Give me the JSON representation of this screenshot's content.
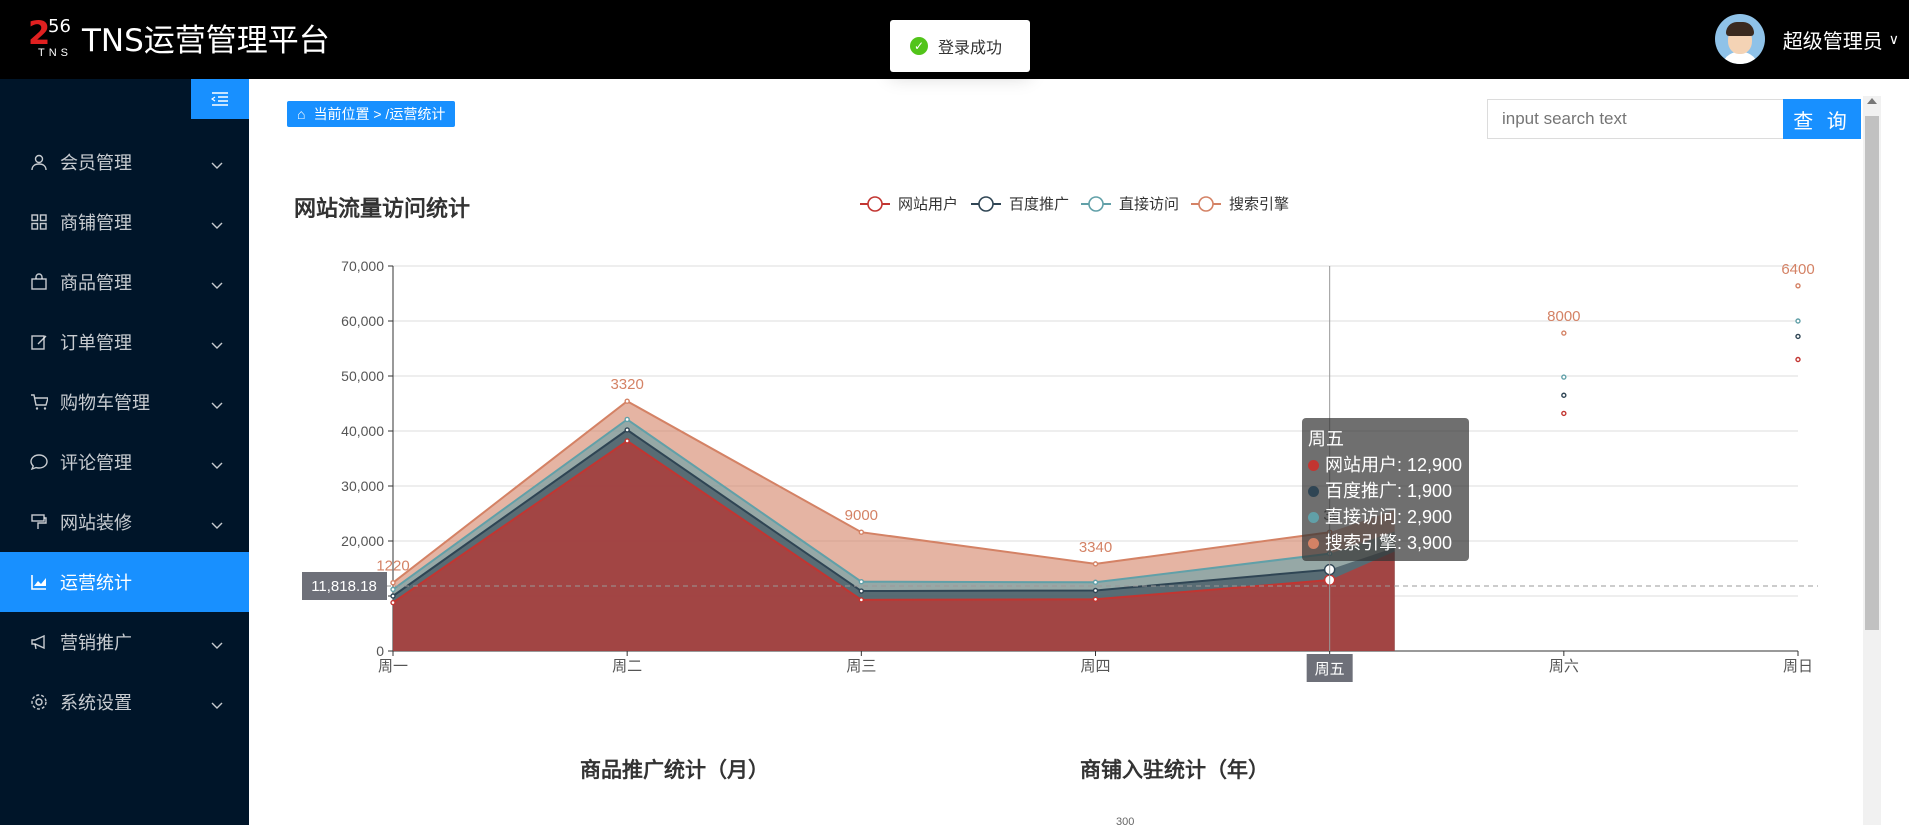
{
  "app": {
    "logo_digit": "2",
    "logo_small": "56",
    "logo_sub": "TNS",
    "title": "TNS运营管理平台"
  },
  "toast": {
    "text": "登录成功",
    "icon": "check-circle-icon",
    "color": "#52c41a"
  },
  "user": {
    "name": "超级管理员"
  },
  "sidebar": {
    "items": [
      {
        "label": "会员管理",
        "icon": "user-icon",
        "active": false
      },
      {
        "label": "商铺管理",
        "icon": "grid-icon",
        "active": false
      },
      {
        "label": "商品管理",
        "icon": "bag-icon",
        "active": false
      },
      {
        "label": "订单管理",
        "icon": "edit-icon",
        "active": false
      },
      {
        "label": "购物车管理",
        "icon": "cart-icon",
        "active": false
      },
      {
        "label": "评论管理",
        "icon": "comment-icon",
        "active": false
      },
      {
        "label": "网站装修",
        "icon": "brush-icon",
        "active": false
      },
      {
        "label": "运营统计",
        "icon": "chart-icon",
        "active": true
      },
      {
        "label": "营销推广",
        "icon": "megaphone-icon",
        "active": false
      },
      {
        "label": "系统设置",
        "icon": "gear-icon",
        "active": false
      }
    ]
  },
  "breadcrumb": {
    "text": "当前位置 > /运营统计"
  },
  "search": {
    "placeholder": "input search text",
    "button": "查 询"
  },
  "page": {
    "chart_title": "网站流量访问统计",
    "sub_title_a": "商品推广统计（月）",
    "sub_title_b": "商铺入驻统计（年）",
    "stub_label": "300"
  },
  "tooltip": {
    "title": "周五",
    "rows": [
      {
        "text": "网站用户: 12,900",
        "color": "#c23531"
      },
      {
        "text": "百度推广: 1,900",
        "color": "#2f4554"
      },
      {
        "text": "直接访问: 2,900",
        "color": "#61a0a8"
      },
      {
        "text": "搜索引擎: 3,900",
        "color": "#d48265"
      }
    ]
  },
  "chart_data": {
    "type": "area",
    "stacked": true,
    "categories": [
      "周一",
      "周二",
      "周三",
      "周四",
      "周五",
      "周六",
      "周日"
    ],
    "ylim": [
      0,
      70000
    ],
    "yticks": [
      0,
      10000,
      20000,
      30000,
      40000,
      50000,
      60000,
      70000
    ],
    "ytick_labels": [
      "0",
      "",
      "20,000",
      "30,000",
      "40,000",
      "50,000",
      "60,000",
      "70,000"
    ],
    "series": [
      {
        "name": "网站用户",
        "color": "#c23531",
        "values": [
          8800,
          38200,
          9300,
          9400,
          12900,
          43200,
          53000
        ]
      },
      {
        "name": "百度推广",
        "color": "#2f4554",
        "values": [
          1200,
          2000,
          1600,
          1600,
          1900,
          3300,
          4200
        ]
      },
      {
        "name": "直接访问",
        "color": "#61a0a8",
        "values": [
          1200,
          1900,
          1700,
          1500,
          2900,
          3300,
          2800
        ]
      },
      {
        "name": "搜索引擎",
        "color": "#d48265",
        "values": [
          1220,
          3320,
          9000,
          3340,
          3900,
          8000,
          6400
        ]
      }
    ],
    "top_labels": [
      "1220",
      "3320",
      "9000",
      "3340",
      "39",
      "8000",
      "6400"
    ],
    "axis_pointer": {
      "y_label": "11,818.18",
      "y_value": 11818.18,
      "x_label": "周五"
    },
    "legend_position": "top-center",
    "grid": true
  }
}
